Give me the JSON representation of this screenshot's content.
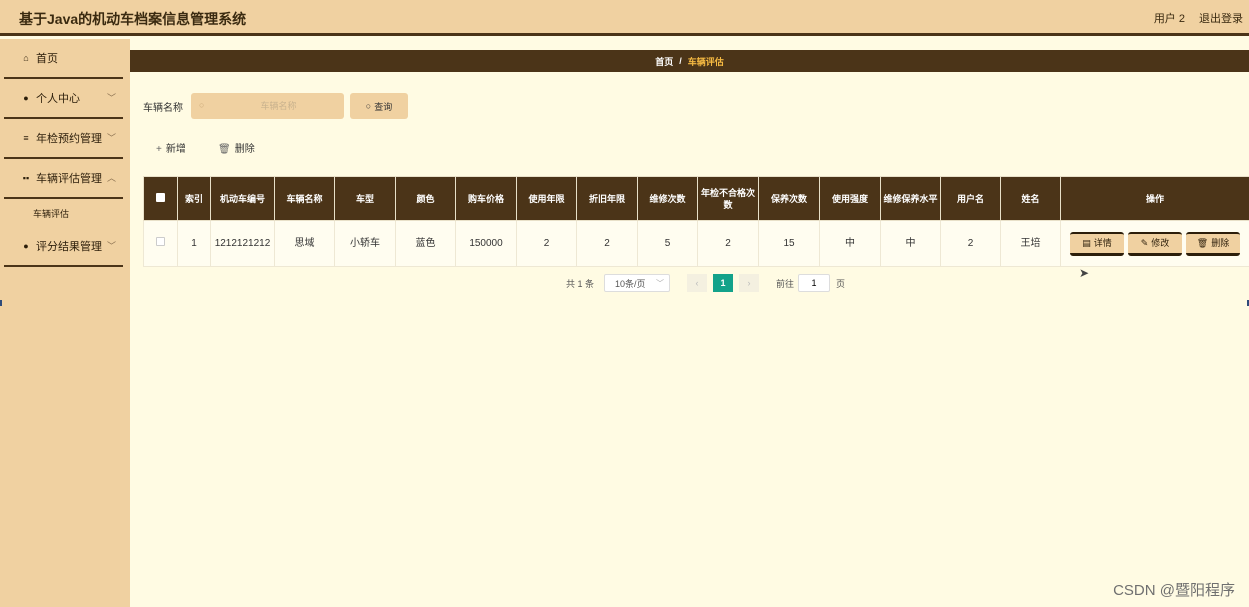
{
  "header": {
    "title": "基于Java的机动车档案信息管理系统",
    "user": "用户 2",
    "logout": "退出登录"
  },
  "sidebar": {
    "items": [
      {
        "label": "首页",
        "icon": "home-icon",
        "glyph": "⌂"
      },
      {
        "label": "个人中心",
        "icon": "user-icon",
        "glyph": "●"
      },
      {
        "label": "年检预约管理",
        "icon": "list-icon",
        "glyph": "≡"
      },
      {
        "label": "车辆评估管理",
        "icon": "grid-icon",
        "glyph": "▪▪"
      },
      {
        "label": "评分结果管理",
        "icon": "user-icon",
        "glyph": "●"
      }
    ],
    "sub_item": "车辆评估"
  },
  "breadcrumb": {
    "home": "首页",
    "sep": "/",
    "current": "车辆评估"
  },
  "search": {
    "label": "车辆名称",
    "placeholder": "车辆名称",
    "button": "查询"
  },
  "actions": {
    "add": "新增",
    "delete": "删除"
  },
  "table": {
    "headers": [
      "索引",
      "机动车编号",
      "车辆名称",
      "车型",
      "颜色",
      "购车价格",
      "使用年限",
      "折旧年限",
      "维修次数",
      "年检不合格次数",
      "保养次数",
      "使用强度",
      "维修保养水平",
      "用户名",
      "姓名",
      "操作"
    ],
    "rows": [
      {
        "index": "1",
        "number": "1212121212",
        "name": "思域",
        "type": "小轿车",
        "color": "蓝色",
        "price": "150000",
        "years": "2",
        "depreciation": "2",
        "repairs": "5",
        "failed": "2",
        "maintenance": "15",
        "intensity": "中",
        "level": "中",
        "username": "2",
        "realname": "王培"
      }
    ],
    "ops": {
      "detail": "详情",
      "edit": "修改",
      "delete": "删除"
    }
  },
  "pagination": {
    "total": "共 1 条",
    "page_size": "10条/页",
    "current": "1",
    "goto": "前往",
    "goto_value": "1",
    "page_unit": "页"
  },
  "watermark": "CSDN @暨阳程序",
  "colors": {
    "header_bg": "#f0d1a1",
    "dark_brown": "#4b3418",
    "content_bg": "#fffbe3",
    "accent_gold": "#f5b942",
    "pager_active": "#13a28a"
  }
}
